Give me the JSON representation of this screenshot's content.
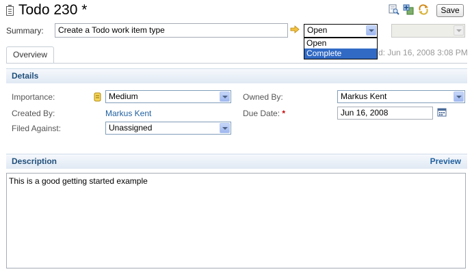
{
  "header": {
    "title": "Todo 230 *",
    "save_label": "Save",
    "icons": [
      "find-icon",
      "add-link-icon",
      "refresh-icon"
    ]
  },
  "summary": {
    "label": "Summary:",
    "value": "Create a Todo work item type"
  },
  "status": {
    "selected": "Open",
    "options": [
      "Open",
      "Complete"
    ],
    "highlighted": "Complete"
  },
  "tabs": [
    {
      "label": "Overview"
    }
  ],
  "meta": {
    "partial_text": "d: Jun 16, 2008 3:08 PM"
  },
  "details": {
    "header": "Details",
    "importance_label": "Importance:",
    "importance_value": "Medium",
    "created_by_label": "Created By:",
    "created_by_value": "Markus Kent",
    "filed_against_label": "Filed Against:",
    "filed_against_value": "Unassigned",
    "owned_by_label": "Owned By:",
    "owned_by_value": "Markus Kent",
    "due_date_label": "Due Date:",
    "due_date_required": "*",
    "due_date_value": "Jun 16, 2008"
  },
  "description": {
    "header": "Description",
    "preview_label": "Preview",
    "text": "This is a good getting started example"
  },
  "colors": {
    "accent": "#1f4e7a",
    "link": "#1f5f9e",
    "selection": "#316ac5",
    "required": "#cc0000"
  }
}
